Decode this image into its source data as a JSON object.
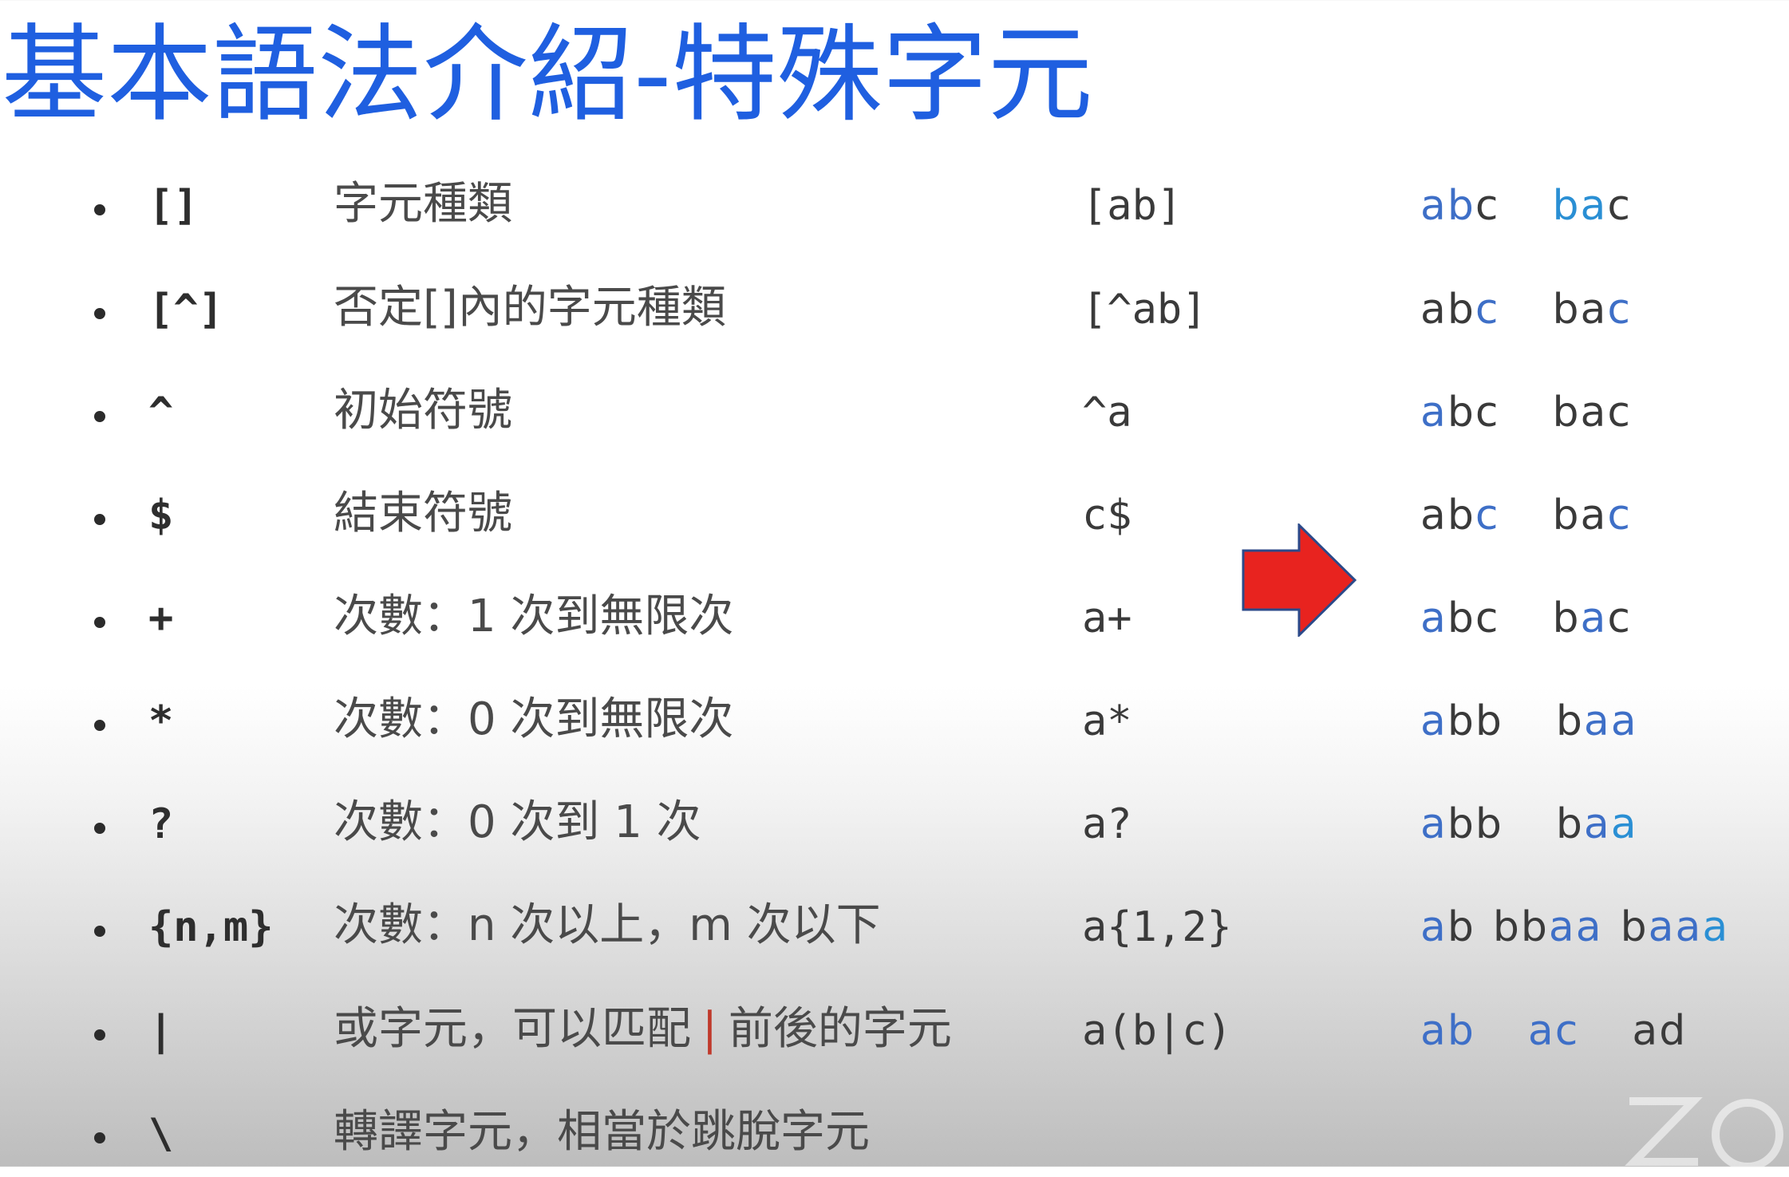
{
  "title": "基本語法介紹-特殊字元",
  "colors": {
    "title": "#1f5fe0",
    "highlight_blue": "#3e6fc7",
    "highlight_cyan": "#2a8fd4",
    "pipe_red": "#c0392b",
    "arrow_fill": "#e8231f",
    "arrow_outline": "#2b4a8a"
  },
  "arrow_icon": "right-arrow-icon",
  "watermark_icon": "zoom-watermark-icon",
  "rows": [
    {
      "symbol": "[]",
      "description": "字元種類",
      "pattern": "[ab]",
      "example_1": "abc",
      "example_2": "bac"
    },
    {
      "symbol": "[^]",
      "description": "否定[]內的字元種類",
      "pattern": "[^ab]",
      "example_1": "abc",
      "example_2": "bac"
    },
    {
      "symbol": "^",
      "description": "初始符號",
      "pattern": "^a",
      "example_1": "abc",
      "example_2": "bac"
    },
    {
      "symbol": "$",
      "description": "結束符號",
      "pattern": "c$",
      "example_1": "abc",
      "example_2": "bac"
    },
    {
      "symbol": "+",
      "description": "次數：1 次到無限次",
      "pattern": "a+",
      "example_1": "abc",
      "example_2": "bac"
    },
    {
      "symbol": "*",
      "description": "次數：0 次到無限次",
      "pattern": "a*",
      "example_1": "abb",
      "example_2": "baa"
    },
    {
      "symbol": "?",
      "description": "次數：0 次到 1 次",
      "pattern": "a?",
      "example_1": "abb",
      "example_2": "baa"
    },
    {
      "symbol": "{n,m}",
      "description": "次數：n 次以上，m 次以下",
      "pattern": "a{1,2}",
      "example_1": "ab",
      "example_2": "bbaa",
      "example_3": "baaa"
    },
    {
      "symbol": "|",
      "description_before": "或字元，可以匹配",
      "description_pipe": "|",
      "description_after": "前後的字元",
      "pattern": "a(b|c)",
      "example_1": "ab",
      "example_2": "ac",
      "example_3": "ad"
    },
    {
      "symbol": "\\",
      "description": "轉譯字元，相當於跳脫字元"
    }
  ]
}
